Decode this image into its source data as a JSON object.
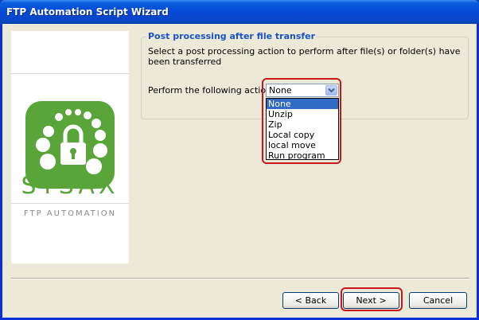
{
  "window": {
    "title": "FTP Automation Script Wizard"
  },
  "branding": {
    "name": "SYSAX",
    "tagline": "FTP AUTOMATION",
    "brand_color": "#5aa53a",
    "icon": "lock-icon"
  },
  "section": {
    "title": "Post processing after file transfer",
    "description": "Select a post processing action to perform after file(s) or folder(s) have been transferred"
  },
  "action": {
    "label": "Perform the following action:",
    "selected": "None",
    "options": [
      "None",
      "Unzip",
      "Zip",
      "Local copy",
      "local move",
      "Run program"
    ]
  },
  "buttons": {
    "back": "< Back",
    "next": "Next >",
    "cancel": "Cancel"
  },
  "colors": {
    "highlight": "#c81818",
    "selection": "#316ac5",
    "legend": "#1b52c4"
  }
}
